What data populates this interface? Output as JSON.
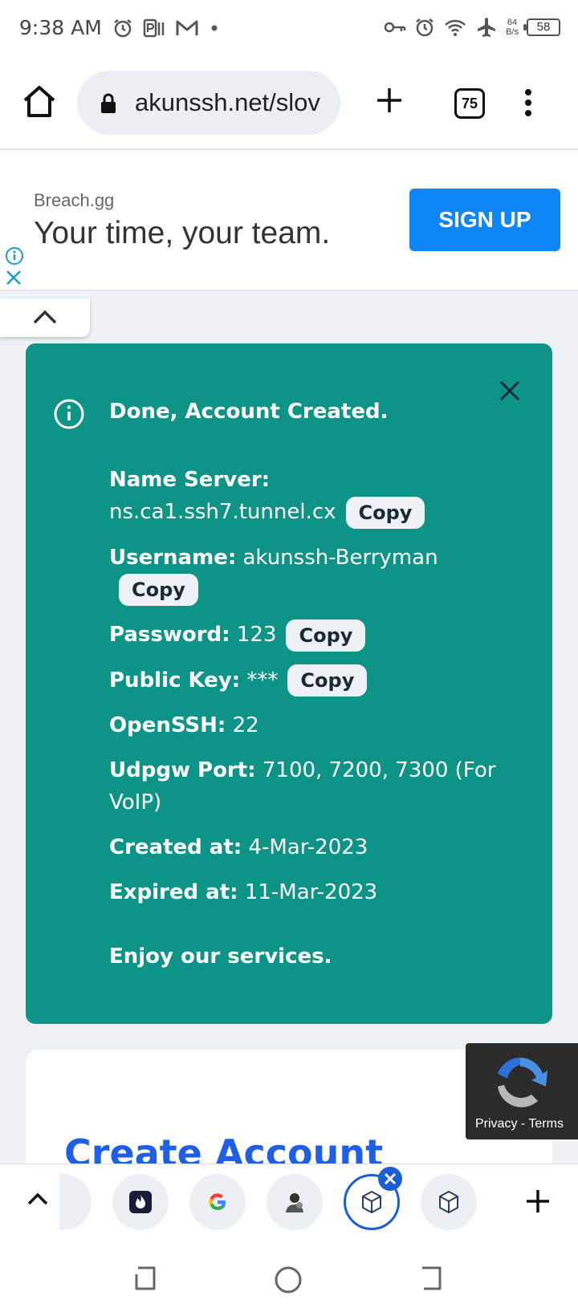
{
  "status_bar": {
    "time": "9:38 AM",
    "net_speed_value": "64",
    "net_speed_unit": "B/s",
    "battery": "58"
  },
  "browser": {
    "url": "akunssh.net/slov",
    "tab_count": "75"
  },
  "ad": {
    "brand": "Breach.gg",
    "headline": "Your time, your team.",
    "cta": "SIGN UP"
  },
  "alert": {
    "title": "Done, Account Created.",
    "name_server_label": "Name Server:",
    "name_server_value": "ns.ca1.ssh7.tunnel.cx",
    "username_label": "Username:",
    "username_value": "akunssh-Berryman",
    "password_label": "Password:",
    "password_value": "123",
    "public_key_label": "Public Key:",
    "public_key_value": "***",
    "openssh_label": "OpenSSH:",
    "openssh_value": "22",
    "udpgw_label": "Udpgw Port:",
    "udpgw_value": "7100, 7200, 7300 (For VoIP)",
    "created_label": "Created at:",
    "created_value": "4-Mar-2023",
    "expired_label": "Expired at:",
    "expired_value": "11-Mar-2023",
    "copy_label": "Copy",
    "footer": "Enjoy our services."
  },
  "card": {
    "heading": "Create Account"
  },
  "recaptcha": {
    "links": "Privacy - Terms"
  },
  "colors": {
    "alert_bg": "#0e9486",
    "signup_bg": "#0f86f5",
    "heading": "#1f5fe6",
    "active_tab": "#1a5fd6"
  }
}
